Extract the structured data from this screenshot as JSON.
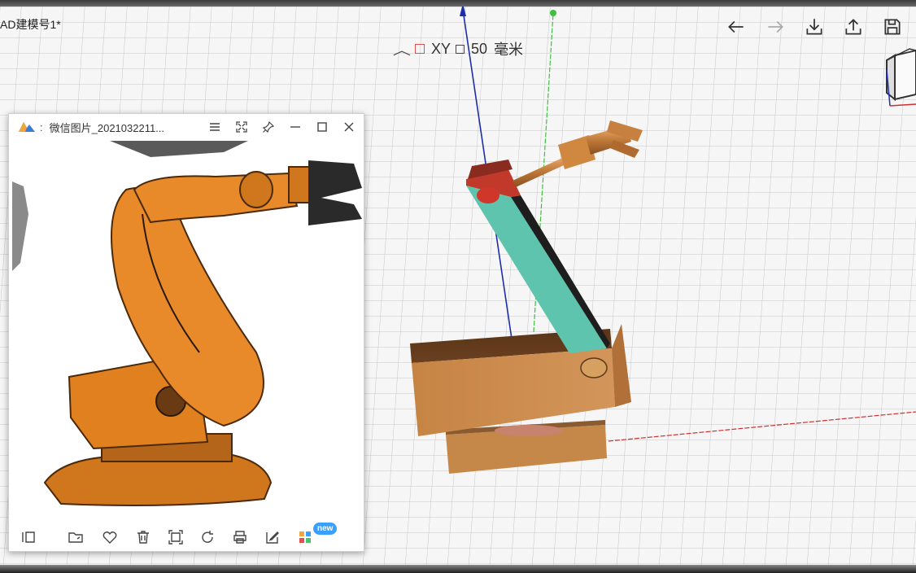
{
  "document": {
    "title": "AD建模号1*"
  },
  "view_info": {
    "plane": "XY",
    "grid_value": "50",
    "grid_unit": "毫米"
  },
  "toolbar": {
    "icons": [
      "undo-arrow-icon",
      "redo-arrow-icon",
      "download-icon",
      "share-upload-icon",
      "save-disk-icon"
    ]
  },
  "viewer": {
    "title": "微信图片_2021032211...",
    "bottom_icons": [
      "sidebar-icon",
      "open-folder-icon",
      "favorite-heart-icon",
      "delete-trash-icon",
      "fit-screen-icon",
      "rotate-icon",
      "print-icon",
      "edit-icon",
      "apps-grid-icon"
    ],
    "badge": "new"
  },
  "colors": {
    "axis_x": "#d03030",
    "axis_y": "#30c030",
    "axis_z": "#2030b0",
    "arm_teal": "#5fc4ad",
    "arm_wood": "#c98a48",
    "joint_red": "#d74a3a",
    "robot_orange": "#e0801e"
  }
}
